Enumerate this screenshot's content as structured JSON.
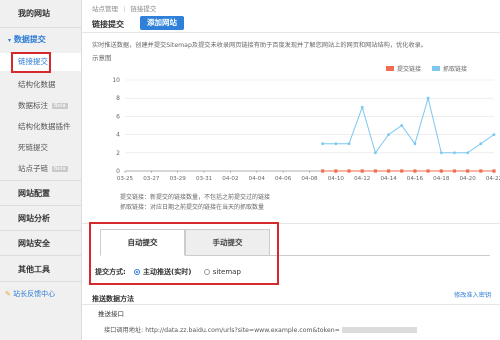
{
  "sidebar": {
    "site": "我的网站",
    "data_submit": "数据提交",
    "sub_items": [
      {
        "label": "链接提交",
        "beta": false
      },
      {
        "label": "结构化数据",
        "beta": false
      },
      {
        "label": "数据标注",
        "beta": true
      },
      {
        "label": "结构化数据插件",
        "beta": false
      },
      {
        "label": "死链提交",
        "beta": false
      },
      {
        "label": "站点子链",
        "beta": true
      }
    ],
    "beta_label": "Beta",
    "sections": [
      "网站配置",
      "网站分析",
      "网站安全",
      "其他工具"
    ],
    "feedback": "站长反馈中心"
  },
  "breadcrumb": {
    "root": "站点管理",
    "sep": "|",
    "current": "链接提交"
  },
  "header": {
    "title": "链接提交",
    "add_site": "添加网站"
  },
  "intro": "实时推送数据，创建并提交Sitemap及提交未收录网页链接有助于百度发现并了解您网站上的网页和网站结构，优化收录。",
  "chart_heading": "示意图",
  "legend": {
    "submitted": "提交链接",
    "crawled": "抓取链接"
  },
  "colors": {
    "submitted": "#f26c4f",
    "crawled": "#7cc8f0",
    "accent": "#2d7bd6",
    "highlight": "#d7282a"
  },
  "chart_data": {
    "type": "line",
    "x": [
      "03-25",
      "03-26",
      "03-27",
      "03-28",
      "03-29",
      "03-30",
      "03-31",
      "04-01",
      "04-02",
      "04-03",
      "04-04",
      "04-05",
      "04-06",
      "04-07",
      "04-08",
      "04-09",
      "04-10",
      "04-11",
      "04-12",
      "04-13",
      "04-14",
      "04-15",
      "04-16",
      "04-17",
      "04-18",
      "04-19",
      "04-20",
      "04-21",
      "04-22"
    ],
    "xticks": [
      "03-25",
      "03-27",
      "03-29",
      "03-31",
      "04-02",
      "04-04",
      "04-06",
      "04-08",
      "04-10",
      "04-12",
      "04-14",
      "04-16",
      "04-18",
      "04-20",
      "04-22"
    ],
    "ylim": [
      0,
      10
    ],
    "yticks": [
      0,
      2,
      4,
      6,
      8,
      10
    ],
    "series": [
      {
        "name": "提交链接",
        "values": [
          null,
          null,
          null,
          null,
          null,
          null,
          null,
          null,
          null,
          null,
          null,
          null,
          null,
          null,
          null,
          0,
          0,
          0,
          0,
          0,
          0,
          0,
          0,
          0,
          0,
          0,
          0,
          0,
          0
        ]
      },
      {
        "name": "抓取链接",
        "values": [
          null,
          null,
          null,
          null,
          null,
          null,
          null,
          null,
          null,
          null,
          null,
          null,
          null,
          null,
          null,
          3,
          3,
          3,
          7,
          2,
          4,
          5,
          3,
          8,
          2,
          2,
          2,
          3,
          4
        ]
      }
    ],
    "grid": true,
    "legend_position": "top-right"
  },
  "notes": [
    "提交链接：新提交的链接数量，不包括之前提交过的链接",
    "抓取链接：对应日期之前提交的链接在当天的抓取数量"
  ],
  "tabs": [
    {
      "label": "自动提交"
    },
    {
      "label": "手动提交"
    }
  ],
  "submit_method": {
    "label": "提交方式:",
    "options": [
      "主动推送(实时)",
      "sitemap"
    ],
    "selected": 0
  },
  "push": {
    "title": "推送数据方法",
    "modify_link": "修改准入密钥",
    "interface_label": "推送接口",
    "api_label": "接口调用地址:",
    "api_url": "http://data.zz.baidu.com/urls?site=www.example.com&token="
  }
}
